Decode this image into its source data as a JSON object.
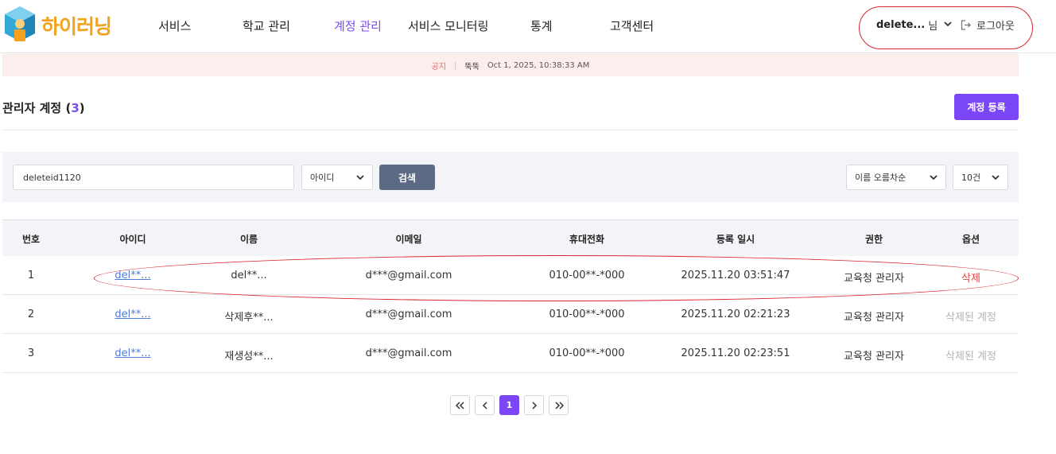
{
  "header": {
    "logo_text": "하이러닝",
    "nav": [
      {
        "label": "서비스"
      },
      {
        "label": "학교 관리"
      },
      {
        "label": "계정 관리"
      },
      {
        "label": "서비스 모니터링"
      },
      {
        "label": "통계"
      },
      {
        "label": "고객센터"
      }
    ],
    "active_nav": "계정 관리",
    "user_name": "delete...",
    "user_suffix": "님",
    "logout_label": "로그아웃"
  },
  "notice": {
    "tag": "공지",
    "title": "뚝뚝",
    "timestamp": "Oct 1, 2025, 10:38:33 AM"
  },
  "page": {
    "title": "관리자 계정",
    "count_open": "(",
    "count": "3",
    "count_close": ")",
    "register_label": "계정 등록"
  },
  "search": {
    "value": "deleteid1120",
    "field_select": "아이디",
    "button_label": "검색",
    "sort_select": "이름 오름차순",
    "page_size_select": "10건"
  },
  "table": {
    "columns": [
      "번호",
      "아이디",
      "이름",
      "이메일",
      "휴대전화",
      "등록 일시",
      "권한",
      "옵션"
    ],
    "rows": [
      {
        "no": "1",
        "id": "del**...",
        "name": "del**...",
        "email": "d***@gmail.com",
        "phone": "010-00**-*000",
        "registered": "2025.11.20 03:51:47",
        "role": "교육청 관리자",
        "option": "삭제",
        "option_state": "delete"
      },
      {
        "no": "2",
        "id": "del**...",
        "name": "삭제후**...",
        "email": "d***@gmail.com",
        "phone": "010-00**-*000",
        "registered": "2025.11.20 02:21:23",
        "role": "교육청 관리자",
        "option": "삭제된 계정",
        "option_state": "deleted"
      },
      {
        "no": "3",
        "id": "del**...",
        "name": "재생성**...",
        "email": "d***@gmail.com",
        "phone": "010-00**-*000",
        "registered": "2025.11.20 02:23:51",
        "role": "교육청 관리자",
        "option": "삭제된 계정",
        "option_state": "deleted"
      }
    ]
  },
  "pagination": {
    "current_page": "1"
  },
  "colors": {
    "accent": "#7b46f5",
    "link": "#4d7bd6",
    "delete": "#e0453f",
    "annotation": "#d9262e"
  }
}
